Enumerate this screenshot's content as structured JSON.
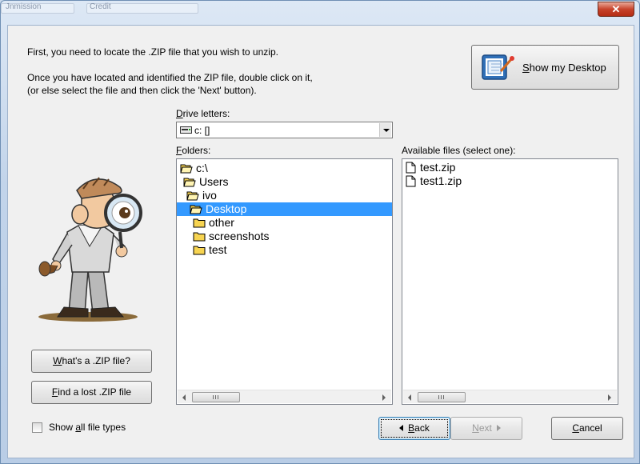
{
  "titlebar": {
    "ghost_labels": [
      "Jnmission",
      "Credit"
    ],
    "close_glyph": "✕"
  },
  "instructions": {
    "line1": "First, you need to locate the .ZIP file that you wish to unzip.",
    "line2": "Once you have located and identified the ZIP file, double click on it,",
    "line3": "(or else select the file and then click the 'Next' button)."
  },
  "show_desktop_button": {
    "label": "Show my Desktop",
    "mnemonic": "S",
    "label_rest": "how my Desktop"
  },
  "drive": {
    "label": "Drive letters:",
    "mnemonic": "D",
    "label_rest": "rive letters:",
    "value": "c: []"
  },
  "folders": {
    "label": "Folders:",
    "mnemonic": "F",
    "label_rest": "olders:",
    "items": [
      {
        "name": "c:\\",
        "level": 0,
        "open": true,
        "selected": false
      },
      {
        "name": "Users",
        "level": 1,
        "open": true,
        "selected": false
      },
      {
        "name": "ivo",
        "level": 2,
        "open": true,
        "selected": false
      },
      {
        "name": "Desktop",
        "level": 3,
        "open": true,
        "selected": true
      },
      {
        "name": "other",
        "level": 4,
        "open": false,
        "selected": false
      },
      {
        "name": "screenshots",
        "level": 4,
        "open": false,
        "selected": false
      },
      {
        "name": "test",
        "level": 4,
        "open": false,
        "selected": false
      }
    ]
  },
  "files": {
    "label": "Available files (select one):",
    "items": [
      "test.zip",
      "test1.zip"
    ]
  },
  "whats_zip_button": {
    "label": "What's a .ZIP file?",
    "mnemonic": "W",
    "label_rest": "hat's a .ZIP file?"
  },
  "find_zip_button": {
    "label": "Find a lost .ZIP file",
    "mnemonic": "F",
    "label_rest": "ind a lost .ZIP file"
  },
  "show_all": {
    "label": "Show all file types",
    "pre": "Show ",
    "mnemonic": "a",
    "post": "ll file types",
    "checked": false
  },
  "back_button": {
    "label": "Back",
    "mnemonic": "B",
    "label_rest": "ack"
  },
  "next_button": {
    "label": "Next",
    "mnemonic": "N",
    "label_rest": "ext"
  },
  "cancel_button": {
    "label": "Cancel",
    "mnemonic": "C",
    "label_rest": "ancel"
  },
  "colors": {
    "selection": "#3399ff",
    "folder": "#f7d451",
    "close": "#c7432b"
  }
}
